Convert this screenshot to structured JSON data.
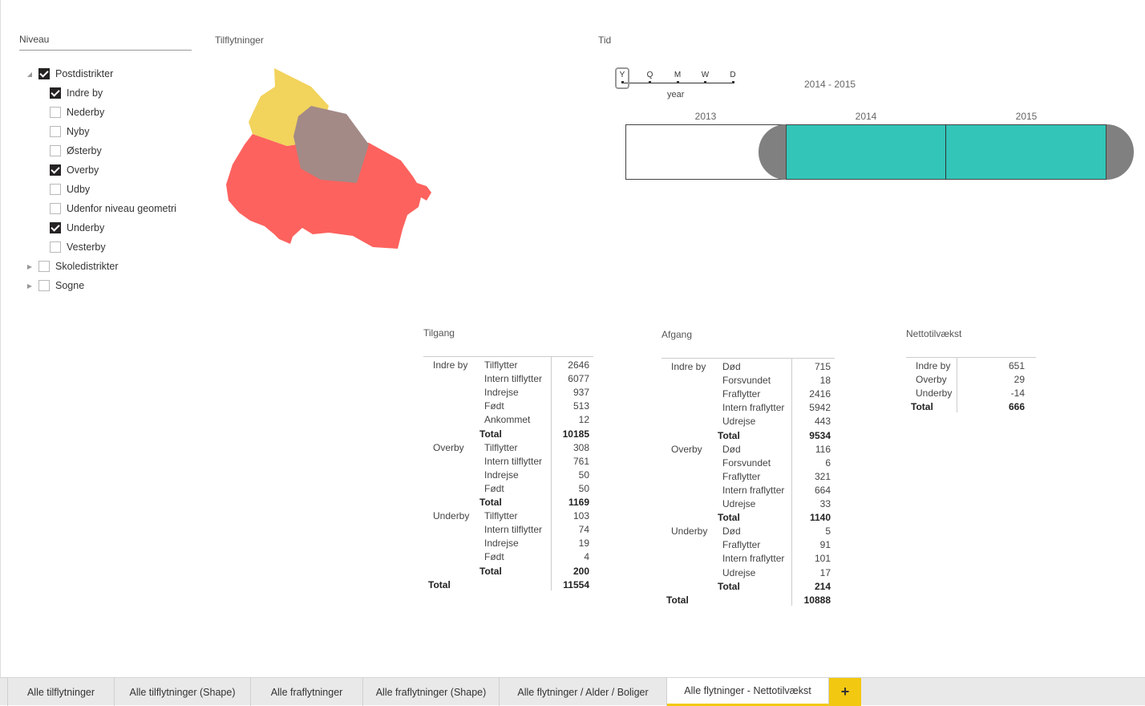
{
  "slicer": {
    "title": "Niveau",
    "items": [
      {
        "label": "Postdistrikter",
        "checked": true,
        "toggle": "◢",
        "level": 0
      },
      {
        "label": "Indre by",
        "checked": true,
        "level": 1
      },
      {
        "label": "Nederby",
        "checked": false,
        "level": 1
      },
      {
        "label": "Nyby",
        "checked": false,
        "level": 1
      },
      {
        "label": "Østerby",
        "checked": false,
        "level": 1
      },
      {
        "label": "Overby",
        "checked": true,
        "level": 1
      },
      {
        "label": "Udby",
        "checked": false,
        "level": 1
      },
      {
        "label": "Udenfor niveau geometri",
        "checked": false,
        "level": 1
      },
      {
        "label": "Underby",
        "checked": true,
        "level": 1
      },
      {
        "label": "Vesterby",
        "checked": false,
        "level": 1
      },
      {
        "label": "Skoledistrikter",
        "checked": false,
        "toggle": "▶",
        "level": 0
      },
      {
        "label": "Sogne",
        "checked": false,
        "toggle": "▶",
        "level": 0
      }
    ]
  },
  "map": {
    "title": "Tilflytninger",
    "colors": {
      "yellow": "#f2d35c",
      "red": "#fd625e",
      "gray": "#a38a87"
    }
  },
  "time": {
    "title": "Tid",
    "granularity": [
      "Y",
      "Q",
      "M",
      "W",
      "D"
    ],
    "granularity_label": "year",
    "range_label": "2014 - 2015",
    "years": [
      "2013",
      "2014",
      "2015"
    ],
    "accent": "#33c5b8"
  },
  "tilgang": {
    "title": "Tilgang",
    "groups": [
      {
        "name": "Indre by",
        "rows": [
          [
            "Tilflytter",
            "2646"
          ],
          [
            "Intern tilflytter",
            "6077"
          ],
          [
            "Indrejse",
            "937"
          ],
          [
            "Født",
            "513"
          ],
          [
            "Ankommet",
            "12"
          ]
        ],
        "total": "10185"
      },
      {
        "name": "Overby",
        "rows": [
          [
            "Tilflytter",
            "308"
          ],
          [
            "Intern tilflytter",
            "761"
          ],
          [
            "Indrejse",
            "50"
          ],
          [
            "Født",
            "50"
          ]
        ],
        "total": "1169"
      },
      {
        "name": "Underby",
        "rows": [
          [
            "Tilflytter",
            "103"
          ],
          [
            "Intern tilflytter",
            "74"
          ],
          [
            "Indrejse",
            "19"
          ],
          [
            "Født",
            "4"
          ]
        ],
        "total": "200"
      }
    ],
    "total_label": "Total",
    "grand_total": "11554"
  },
  "afgang": {
    "title": "Afgang",
    "groups": [
      {
        "name": "Indre by",
        "rows": [
          [
            "Død",
            "715"
          ],
          [
            "Forsvundet",
            "18"
          ],
          [
            "Fraflytter",
            "2416"
          ],
          [
            "Intern fraflytter",
            "5942"
          ],
          [
            "Udrejse",
            "443"
          ]
        ],
        "total": "9534"
      },
      {
        "name": "Overby",
        "rows": [
          [
            "Død",
            "116"
          ],
          [
            "Forsvundet",
            "6"
          ],
          [
            "Fraflytter",
            "321"
          ],
          [
            "Intern fraflytter",
            "664"
          ],
          [
            "Udrejse",
            "33"
          ]
        ],
        "total": "1140"
      },
      {
        "name": "Underby",
        "rows": [
          [
            "Død",
            "5"
          ],
          [
            "Fraflytter",
            "91"
          ],
          [
            "Intern fraflytter",
            "101"
          ],
          [
            "Udrejse",
            "17"
          ]
        ],
        "total": "214"
      }
    ],
    "total_label": "Total",
    "grand_total": "10888"
  },
  "netto": {
    "title": "Nettotilvækst",
    "rows": [
      [
        "Indre by",
        "651"
      ],
      [
        "Overby",
        "29"
      ],
      [
        "Underby",
        "-14"
      ]
    ],
    "total_label": "Total",
    "total": "666"
  },
  "tabs": [
    {
      "label": "Alle tilflytninger",
      "active": false
    },
    {
      "label": "Alle tilflytninger (Shape)",
      "active": false
    },
    {
      "label": "Alle fraflytninger",
      "active": false
    },
    {
      "label": "Alle fraflytninger (Shape)",
      "active": false
    },
    {
      "label": "Alle flytninger / Alder / Boliger",
      "active": false
    },
    {
      "label": "Alle flytninger - Nettotilvækst",
      "active": true
    }
  ],
  "add_tab_label": "+"
}
